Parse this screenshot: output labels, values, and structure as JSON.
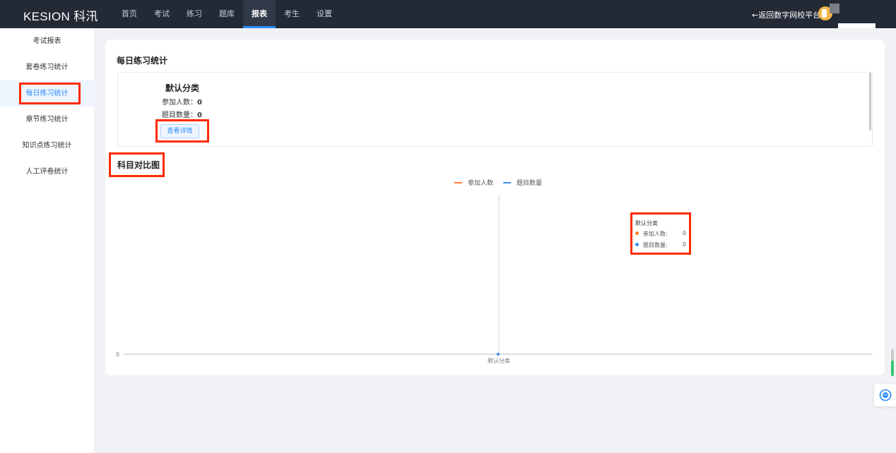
{
  "header": {
    "logo": "KESION 科汛",
    "nav": [
      {
        "label": "首页"
      },
      {
        "label": "考试"
      },
      {
        "label": "练习"
      },
      {
        "label": "题库"
      },
      {
        "label": "报表"
      },
      {
        "label": "考生"
      },
      {
        "label": "设置"
      }
    ],
    "active_nav": "报表",
    "back_link": "←返回数字网校平台"
  },
  "sidebar": {
    "items": [
      {
        "label": "考试报表"
      },
      {
        "label": "套卷练习统计"
      },
      {
        "label": "每日练习统计"
      },
      {
        "label": "章节练习统计"
      },
      {
        "label": "知识点练习统计"
      },
      {
        "label": "人工评卷统计"
      }
    ],
    "active_item": "每日练习统计"
  },
  "main": {
    "title": "每日练习统计",
    "category": {
      "name": "默认分类",
      "participants_label": "参加人数：",
      "participants_value": "0",
      "questions_label": "题目数量：",
      "questions_value": "0",
      "detail_button": "查看详情"
    },
    "chart_title": "科目对比图"
  },
  "chart_data": {
    "type": "line",
    "categories": [
      "默认分类"
    ],
    "series": [
      {
        "name": "参加人数",
        "values": [
          0
        ],
        "color": "#ff7a2e"
      },
      {
        "name": "题目数量",
        "values": [
          0
        ],
        "color": "#3f8ef5"
      }
    ],
    "y_ticks": [
      "0"
    ],
    "legend_position": "top-center",
    "tooltip": {
      "title": "默认分类",
      "rows": [
        {
          "label": "参加人数:",
          "value": "0"
        },
        {
          "label": "题目数量:",
          "value": "0"
        }
      ]
    }
  },
  "colors": {
    "topbar": "#232a35",
    "accent": "#2e8bff",
    "highlight": "#ff2a00"
  }
}
